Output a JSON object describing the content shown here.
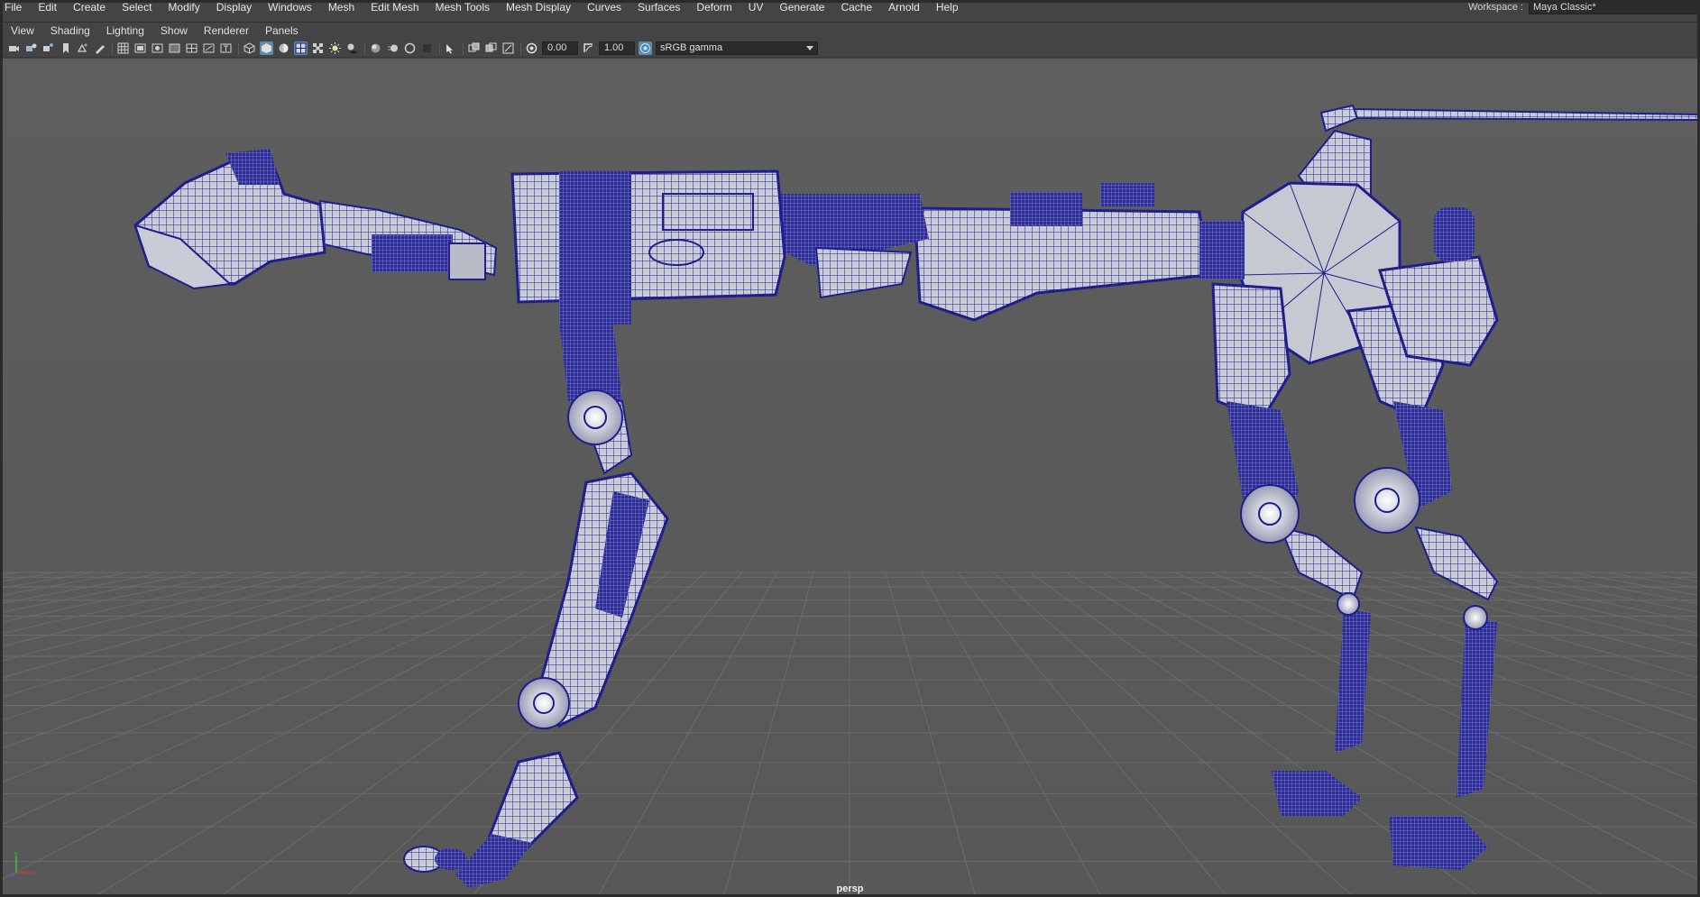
{
  "main_menu": {
    "items": [
      "File",
      "Edit",
      "Create",
      "Select",
      "Modify",
      "Display",
      "Windows",
      "Mesh",
      "Edit Mesh",
      "Mesh Tools",
      "Mesh Display",
      "Curves",
      "Surfaces",
      "Deform",
      "UV",
      "Generate",
      "Cache",
      "Arnold",
      "Help"
    ]
  },
  "workspace": {
    "label": "Workspace :",
    "value": "Maya Classic*"
  },
  "panel_menu": {
    "items": [
      "View",
      "Shading",
      "Lighting",
      "Show",
      "Renderer",
      "Panels"
    ]
  },
  "toolbar": {
    "exposure_value": "0.00",
    "gamma_value": "1.00",
    "color_space": "sRGB gamma"
  },
  "viewport": {
    "camera_label": "persp"
  },
  "colors": {
    "wire": "#1e1e8c",
    "mesh_light": "#c9cbd6",
    "grid": "#6a6a6a",
    "active_tool": "#5b8cae"
  },
  "icons": {
    "toolbar": [
      "camera-icon",
      "camera-attributes-icon",
      "bookmark-icon",
      "image-plane-icon",
      "2d-pan-zoom-icon",
      "grease-pencil-icon",
      "grid-icon",
      "film-gate-icon",
      "resolution-gate-icon",
      "gate-mask-icon",
      "field-chart-icon",
      "safe-action-icon",
      "safe-title-icon",
      "wireframe-icon",
      "smooth-shade-icon",
      "default-material-icon",
      "wireframe-on-shaded-icon",
      "textured-icon",
      "use-all-lights-icon",
      "shadows-icon",
      "screen-space-ao-icon",
      "motion-blur-icon",
      "anti-aliasing-icon",
      "depth-of-field-icon",
      "isolate-select-icon",
      "xray-icon",
      "xray-active-icon",
      "xray-joints-icon",
      "exposure-icon",
      "gamma-icon",
      "color-management-icon"
    ]
  }
}
